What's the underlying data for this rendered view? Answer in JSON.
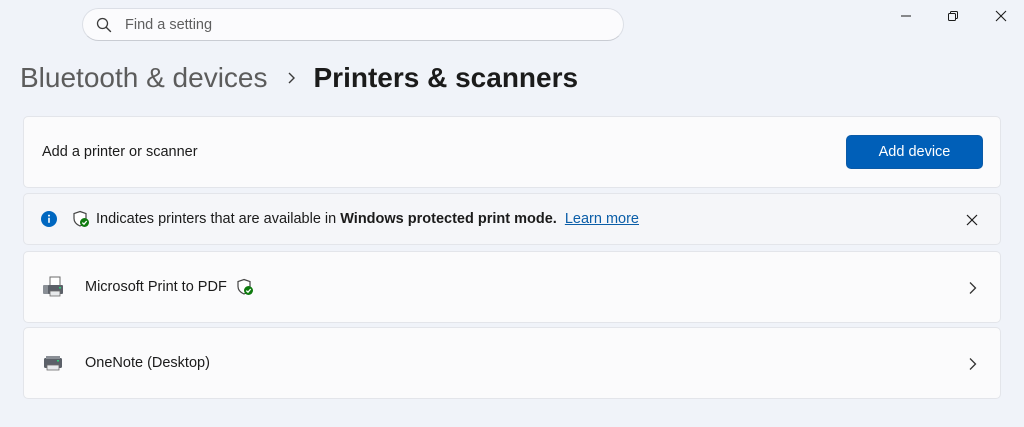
{
  "search": {
    "placeholder": "Find a setting",
    "value": ""
  },
  "window_controls": [
    "minimize",
    "restore",
    "close"
  ],
  "breadcrumb": {
    "parent": "Bluetooth & devices",
    "current": "Printers & scanners"
  },
  "add_card": {
    "label": "Add a printer or scanner",
    "button_label": "Add device"
  },
  "info_bar": {
    "text_before": "Indicates printers that are available in",
    "text_bold": "Windows protected print mode.",
    "link": "Learn more"
  },
  "devices": [
    {
      "name": "Microsoft Print to PDF",
      "protected_print": true,
      "icon": "printer-fax-icon"
    },
    {
      "name": "OneNote (Desktop)",
      "protected_print": false,
      "icon": "printer-icon"
    }
  ],
  "colors": {
    "accent": "#005fb8",
    "background": "#f0f3f9",
    "card": "#fbfbfc",
    "info_blue": "#0067c0",
    "shield_check": "#0f7b0f",
    "link": "#0b5ea8"
  }
}
